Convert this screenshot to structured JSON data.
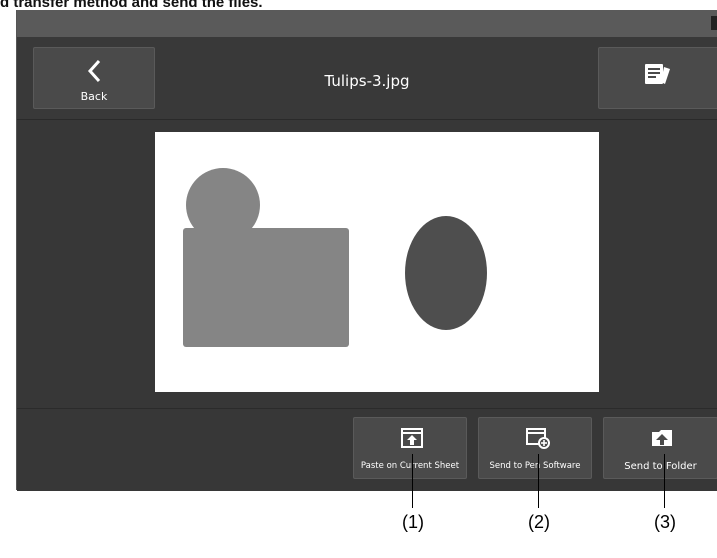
{
  "page_heading": "d transfer method and send the files.",
  "header": {
    "back_label": "Back",
    "title": "Tulips-3.jpg",
    "back_icon": "chevron-left-icon",
    "info_icon": "document-icon"
  },
  "actions": [
    {
      "label": "Paste on Current Sheet",
      "icon": "paste-sheet-icon",
      "callout": "(1)"
    },
    {
      "label": "Send to Pen Software",
      "icon": "pen-software-icon",
      "callout": "(2)"
    },
    {
      "label": "Send to Folder",
      "icon": "folder-upload-icon",
      "callout": "(3)"
    }
  ],
  "colors": {
    "app_background": "#373737",
    "button_background": "#4a4a4a",
    "shape_light": "#858585",
    "shape_dark": "#4e4e4e"
  }
}
